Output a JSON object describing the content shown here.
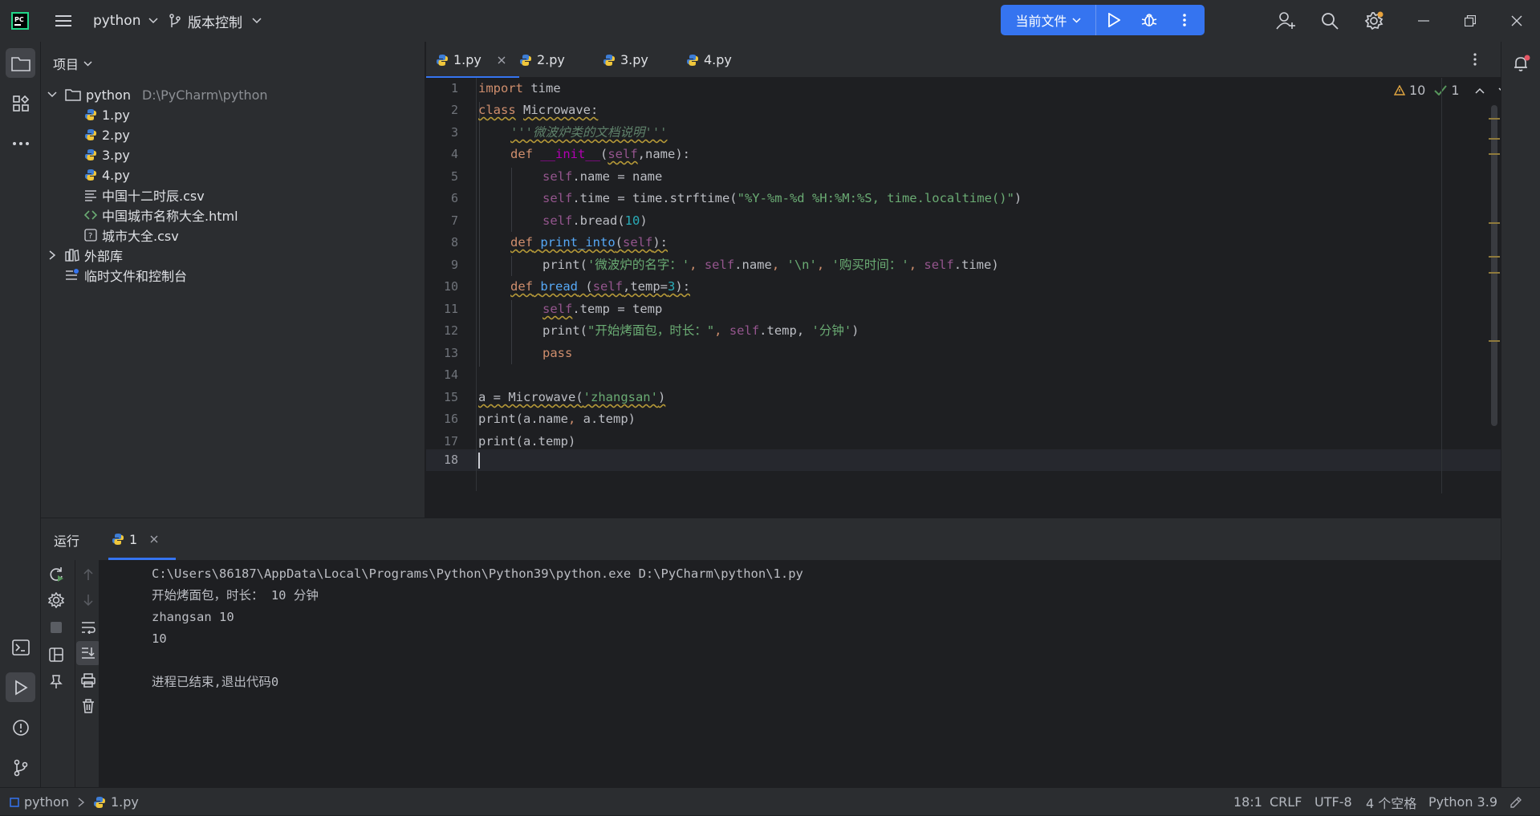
{
  "titlebar": {
    "project": "python",
    "vcs": "版本控制",
    "run_config": "当前文件"
  },
  "project_panel": {
    "header": "项目",
    "root": {
      "name": "python",
      "path": "D:\\PyCharm\\python"
    },
    "files": [
      "1.py",
      "2.py",
      "3.py",
      "4.py",
      "中国十二时辰.csv",
      "中国城市名称大全.html",
      "城市大全.csv"
    ],
    "external_libs": "外部库",
    "scratches": "临时文件和控制台"
  },
  "tabs": [
    "1.py",
    "2.py",
    "3.py",
    "4.py"
  ],
  "editor": {
    "line_numbers": [
      "1",
      "2",
      "3",
      "4",
      "5",
      "6",
      "7",
      "8",
      "9",
      "10",
      "11",
      "12",
      "13",
      "14",
      "15",
      "16",
      "17",
      "18"
    ],
    "warnings_count": "10",
    "ok_count": "1",
    "code": {
      "l1_kw": "import",
      "l1_rest": " time",
      "l2_kw": "class",
      "l2_name": "Microwave:",
      "l3_doc": "'''微波炉类的文档说明'''",
      "l4_def": "def",
      "l4_fn": "__init__",
      "l4_open": "(",
      "l4_self": "self",
      "l4_rest": ",name):",
      "l5_self": "self",
      "l5_rest": ".name = name",
      "l6_self": "self",
      "l6_mid": ".time = time.strftime(",
      "l6_str": "\"%Y-%m-%d %H:%M:%S, time.localtime()\"",
      "l6_end": ")",
      "l7_self": "self",
      "l7_mid": ".bread(",
      "l7_num": "10",
      "l7_end": ")",
      "l8_def": "def",
      "l8_fn": "print_into",
      "l8_open": "(",
      "l8_self": "self",
      "l8_end": "):",
      "l9_a": "print(",
      "l9_s1": "'微波炉的名字：'",
      "l9_c1": ", ",
      "l9_self": "self",
      "l9_b": ".name",
      "l9_c2": ", ",
      "l9_s2": "'\\n'",
      "l9_c3": ", ",
      "l9_s3": "'购买时间：'",
      "l9_c4": ", ",
      "l9_self2": "self",
      "l9_end": ".time)",
      "l10_def": "def",
      "l10_fn": "bread",
      "l10_open": " (",
      "l10_self": "self",
      "l10_mid": ",temp=",
      "l10_num": "3",
      "l10_end": "):",
      "l11_self": "self",
      "l11_rest": ".temp = temp",
      "l12_a": "print(",
      "l12_s1": "\"开始烤面包，时长：\"",
      "l12_c1": ", ",
      "l12_self": "self",
      "l12_b": ".temp, ",
      "l12_s2": "'分钟'",
      "l12_end": ")",
      "l13_kw": "pass",
      "l15_a": "a = Microwave(",
      "l15_s": "'zhangsan'",
      "l15_end": ")",
      "l16_a": "print(a.name",
      "l16_c": ", ",
      "l16_b": "a.temp)",
      "l17": "print(a.temp)"
    }
  },
  "run_panel": {
    "title": "运行",
    "tab": "1",
    "output": [
      "C:\\Users\\86187\\AppData\\Local\\Programs\\Python\\Python39\\python.exe D:\\PyCharm\\python\\1.py",
      "开始烤面包，时长： 10 分钟",
      "zhangsan 10",
      "10",
      "",
      "进程已结束,退出代码0"
    ]
  },
  "statusbar": {
    "crumb_project": "python",
    "crumb_file": "1.py",
    "position": "18:1",
    "line_sep": "CRLF",
    "encoding": "UTF-8",
    "indent": "4 个空格",
    "interpreter": "Python 3.9"
  },
  "colors": {
    "accent": "#3574f0",
    "bg": "#1e1f22",
    "panel": "#2b2d30"
  }
}
